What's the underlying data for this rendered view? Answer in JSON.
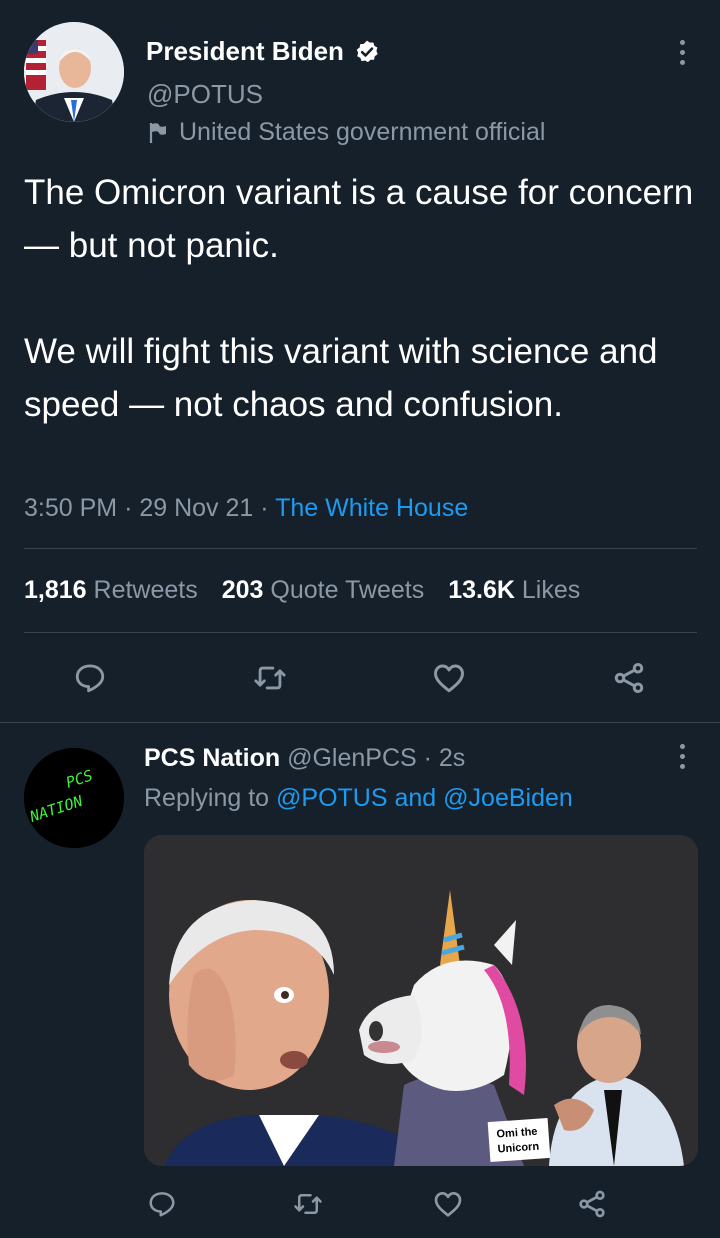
{
  "tweet": {
    "author_name": "President Biden",
    "handle": "@POTUS",
    "label": "United States government official",
    "text_paragraphs": [
      "The Omicron variant is a cause for concern — but not panic.",
      "We will fight this variant with science and speed — not chaos and confusion."
    ],
    "time": "3:50 PM",
    "date": "29 Nov 21",
    "source": "The White House",
    "stats": {
      "retweets_count": "1,816",
      "retweets_label": "Retweets",
      "quotes_count": "203",
      "quotes_label": "Quote Tweets",
      "likes_count": "13.6K",
      "likes_label": "Likes"
    }
  },
  "reply": {
    "author_name": "PCS Nation",
    "handle": "@GlenPCS",
    "time": "2s",
    "replying_prefix": "Replying to",
    "replying_1": "@POTUS",
    "replying_and": "and",
    "replying_2": "@JoeBiden",
    "avatar_text_1": "PCS",
    "avatar_text_2": "NATION",
    "image_caption_1": "Omi the",
    "image_caption_2": "Unicorn"
  },
  "colors": {
    "background": "#15202b",
    "accent": "#1d9bf0",
    "muted": "#8b98a5",
    "divider": "#38444d",
    "verified": "#ffffff"
  },
  "icons": [
    "more-icon",
    "verified-icon",
    "flag-icon",
    "reply-icon",
    "retweet-icon",
    "like-icon",
    "share-icon"
  ]
}
